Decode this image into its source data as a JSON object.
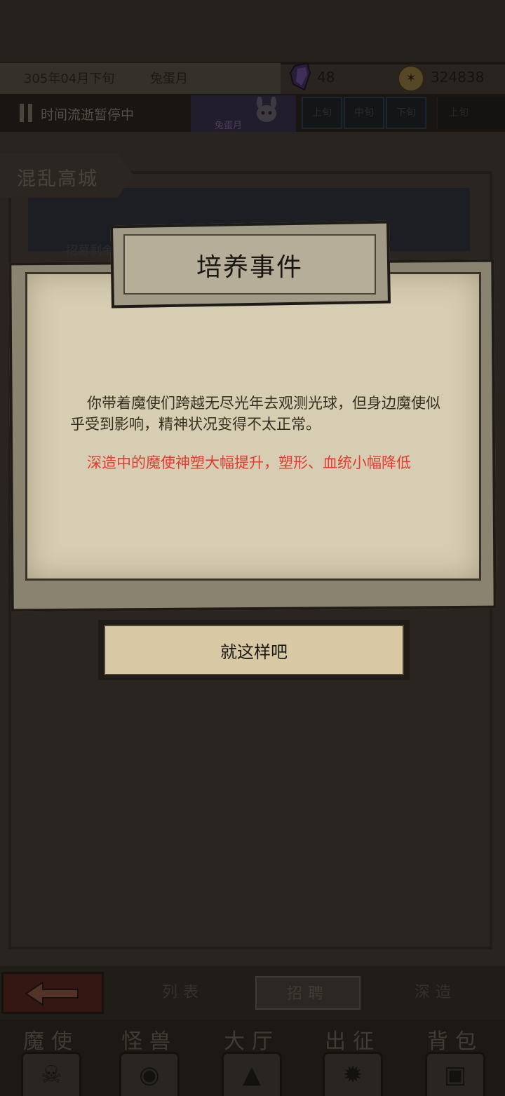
{
  "header": {
    "date": "305年04月下旬",
    "month_name": "兔蛋月",
    "crystal_count": "48",
    "coin_count": "324838"
  },
  "time_bar": {
    "status": "时间流逝暂停中",
    "event_label": "兔蛋月",
    "periods": [
      "上旬",
      "中旬",
      "下旬"
    ],
    "extra": "上旬"
  },
  "location": {
    "name": "混乱高城",
    "recruit_label": "招募剩余"
  },
  "dialog": {
    "title": "培养事件",
    "body": "你带着魔使们跨越无尽光年去观测光球，但身边魔使似乎受到影响，精神状况变得不太正常。",
    "effect": "深造中的魔使神塑大幅提升，塑形、血统小幅降低",
    "confirm_label": "就这样吧"
  },
  "subnav": {
    "tabs": [
      "列表",
      "招聘",
      "深造"
    ],
    "active": "招聘"
  },
  "mainnav": {
    "items": [
      {
        "label": "魔使",
        "icon": "skull-icon"
      },
      {
        "label": "怪兽",
        "icon": "monster-icon"
      },
      {
        "label": "大厅",
        "icon": "hall-icon"
      },
      {
        "label": "出征",
        "icon": "expedition-icon"
      },
      {
        "label": "背包",
        "icon": "backpack-icon"
      }
    ]
  },
  "colors": {
    "paper": "#d6cdb3",
    "effect_text": "#e33b32",
    "frame": "#1f1b16"
  }
}
